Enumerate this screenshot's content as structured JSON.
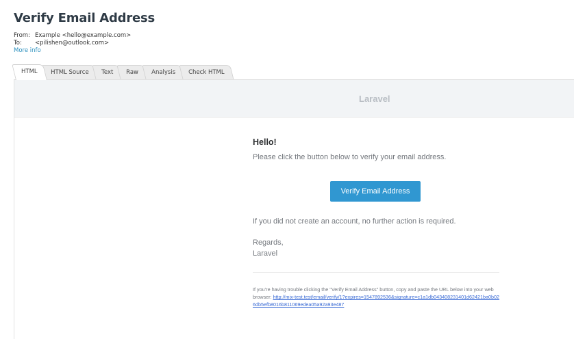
{
  "message": {
    "subject": "Verify Email Address",
    "from_label": "From:",
    "from_value": "Example <hello@example.com>",
    "to_label": "To:",
    "to_value": "<pilishen@outlook.com>",
    "more_info": "More info"
  },
  "tabs": [
    {
      "label": "HTML",
      "active": true
    },
    {
      "label": "HTML Source",
      "active": false
    },
    {
      "label": "Text",
      "active": false
    },
    {
      "label": "Raw",
      "active": false
    },
    {
      "label": "Analysis",
      "active": false
    },
    {
      "label": "Check HTML",
      "active": false
    }
  ],
  "email": {
    "brand": "Laravel",
    "greeting": "Hello!",
    "intro": "Please click the button below to verify your email address.",
    "button": "Verify Email Address",
    "outro": "If you did not create an account, no further action is required.",
    "regards": "Regards,",
    "signature": "Laravel",
    "footer_text": "If you’re having trouble clicking the \"Verify Email Address\" button, copy and paste the URL below into your web browser: ",
    "footer_url": "http://mix-test.test/email/verify/1?expires=1547892536&signature=c1a1db043408231401d62421ba0b026db5efb8016b811069edea05a92a93e487"
  },
  "colors": {
    "accent_button": "#3097d1",
    "link": "#3869d4",
    "more_info_link": "#2a8fbd"
  }
}
